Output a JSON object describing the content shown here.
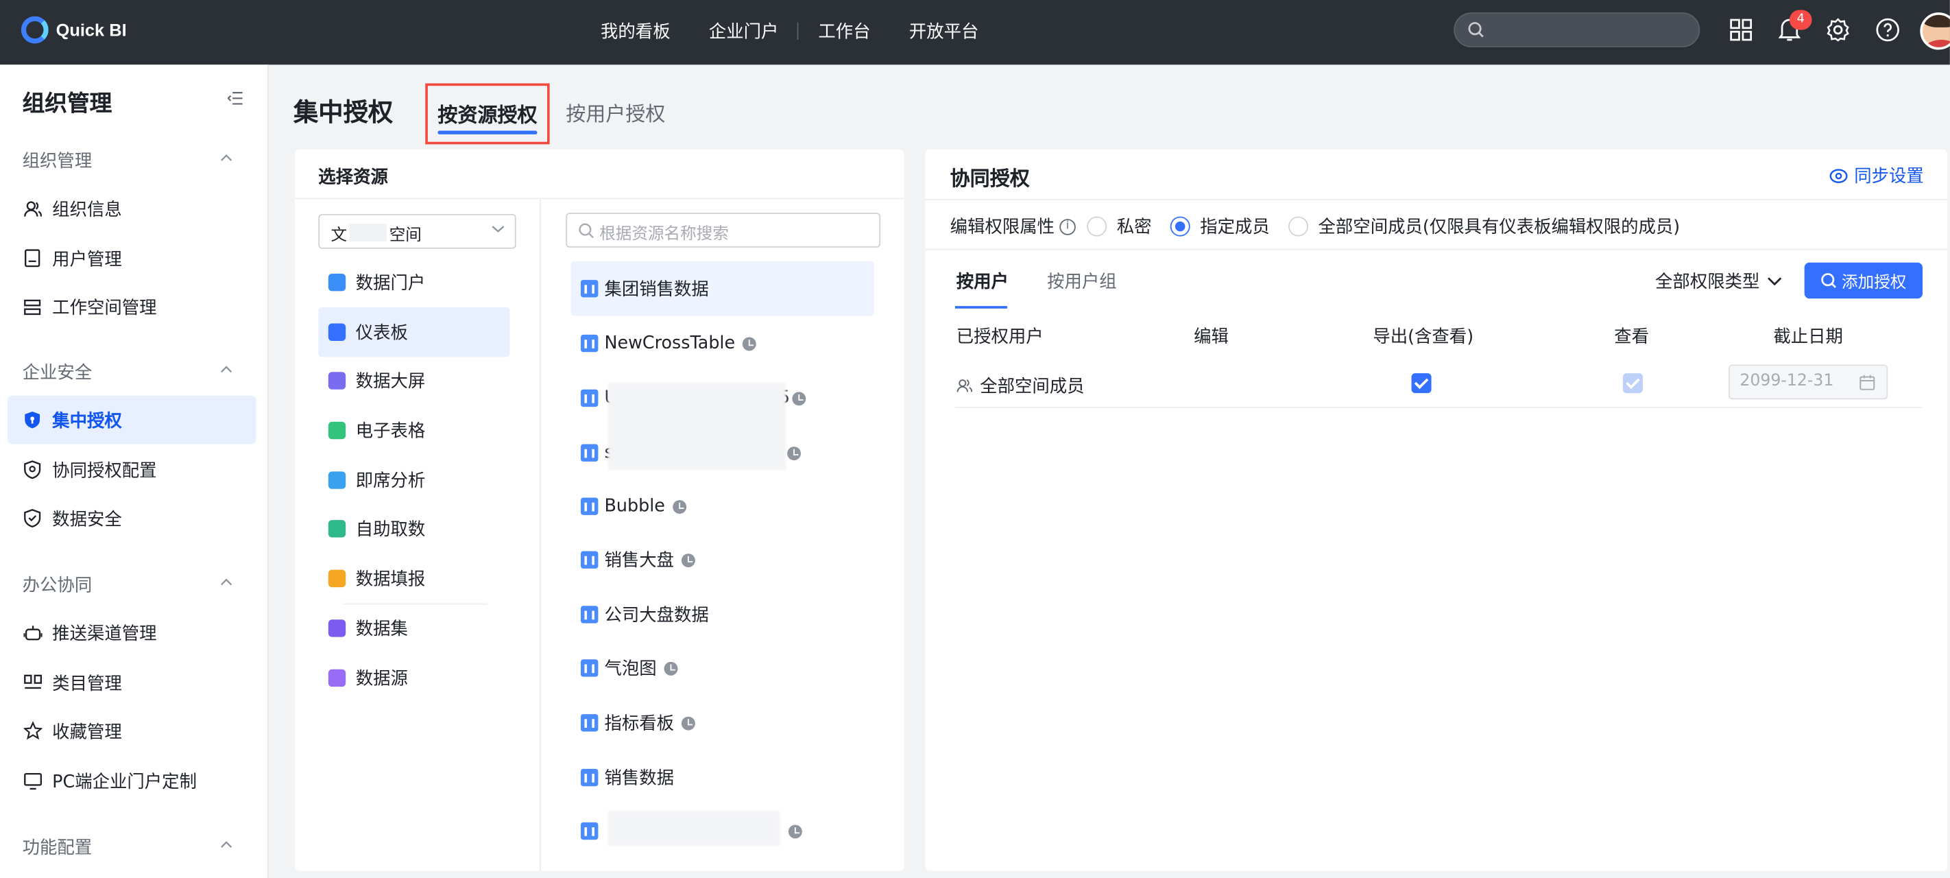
{
  "app": {
    "name": "Quick BI"
  },
  "topnav": {
    "items": [
      "我的看板",
      "企业门户",
      "工作台",
      "开放平台"
    ],
    "search_placeholder": "",
    "notification_count": "4"
  },
  "sidebar": {
    "title": "组织管理",
    "groups": [
      {
        "label": "组织管理",
        "items": [
          {
            "label": "组织信息",
            "icon": "users-icon"
          },
          {
            "label": "用户管理",
            "icon": "user-doc-icon"
          },
          {
            "label": "工作空间管理",
            "icon": "stack-icon"
          }
        ]
      },
      {
        "label": "企业安全",
        "items": [
          {
            "label": "集中授权",
            "icon": "shield-filled-icon",
            "active": true
          },
          {
            "label": "协同授权配置",
            "icon": "shield-gear-icon"
          },
          {
            "label": "数据安全",
            "icon": "shield-check-icon"
          }
        ]
      },
      {
        "label": "办公协同",
        "items": [
          {
            "label": "推送渠道管理",
            "icon": "robot-icon"
          },
          {
            "label": "类目管理",
            "icon": "category-icon"
          },
          {
            "label": "收藏管理",
            "icon": "star-icon"
          },
          {
            "label": "PC端企业门户定制",
            "icon": "monitor-icon"
          }
        ]
      },
      {
        "label": "功能配置",
        "items": []
      }
    ]
  },
  "header": {
    "title": "集中授权",
    "tabs": [
      "按资源授权",
      "按用户授权"
    ],
    "active_tab": "按资源授权"
  },
  "resource_panel": {
    "title": "选择资源",
    "workspace": {
      "prefix": "文",
      "suffix": "空间"
    },
    "types": [
      {
        "label": "数据门户",
        "color": "#3a8ef6"
      },
      {
        "label": "仪表板",
        "color": "#3370ff",
        "active": true
      },
      {
        "label": "数据大屏",
        "color": "#7a6cf0"
      },
      {
        "label": "电子表格",
        "color": "#34c37a"
      },
      {
        "label": "即席分析",
        "color": "#3aa0f0"
      },
      {
        "label": "自助取数",
        "color": "#2fb88a"
      },
      {
        "label": "数据填报",
        "color": "#f5a623"
      },
      {
        "label": "数据集",
        "color": "#7a5cf0"
      },
      {
        "label": "数据源",
        "color": "#9a6cf5"
      }
    ],
    "search_placeholder": "根据资源名称搜索",
    "resources": [
      {
        "name": "集团销售数据",
        "clock": false,
        "active": true
      },
      {
        "name": "NewCrossTable",
        "clock": true
      },
      {
        "name": "U",
        "clock": true,
        "tail": "5"
      },
      {
        "name": "s",
        "clock": true
      },
      {
        "name": "Bubble",
        "clock": true
      },
      {
        "name": "销售大盘",
        "clock": true
      },
      {
        "name": "公司大盘数据",
        "clock": false
      },
      {
        "name": "气泡图",
        "clock": true
      },
      {
        "name": "指标看板",
        "clock": true
      },
      {
        "name": "销售数据",
        "clock": false
      },
      {
        "name": "",
        "clock": true
      }
    ]
  },
  "collab_panel": {
    "title": "协同授权",
    "sync_label": "同步设置",
    "perm_attr_label": "编辑权限属性",
    "radio_options": [
      "私密",
      "指定成员",
      "全部空间成员(仅限具有仪表板编辑权限的成员)"
    ],
    "radio_selected": "指定成员",
    "subtabs": [
      "按用户",
      "按用户组"
    ],
    "perm_type_label": "全部权限类型",
    "add_button_label": "添加授权",
    "columns": [
      "已授权用户",
      "编辑",
      "导出(含查看)",
      "查看",
      "截止日期"
    ],
    "rows": [
      {
        "user": "全部空间成员",
        "edit": false,
        "export": true,
        "view": true,
        "view_disabled": true,
        "expiry": "2099-12-31"
      }
    ]
  },
  "colors": {
    "accent": "#3370ff",
    "topbar": "#2b2f36",
    "highlight_border": "#f5493e"
  }
}
